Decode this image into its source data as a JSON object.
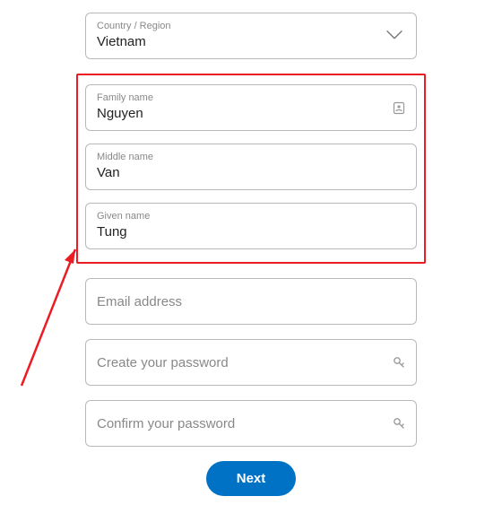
{
  "country": {
    "label": "Country / Region",
    "value": "Vietnam"
  },
  "family_name": {
    "label": "Family name",
    "value": "Nguyen"
  },
  "middle_name": {
    "label": "Middle name",
    "value": "Van"
  },
  "given_name": {
    "label": "Given name",
    "value": "Tung"
  },
  "email_placeholder": "Email address",
  "password_placeholder": "Create your password",
  "confirm_placeholder": "Confirm your password",
  "next_label": "Next"
}
